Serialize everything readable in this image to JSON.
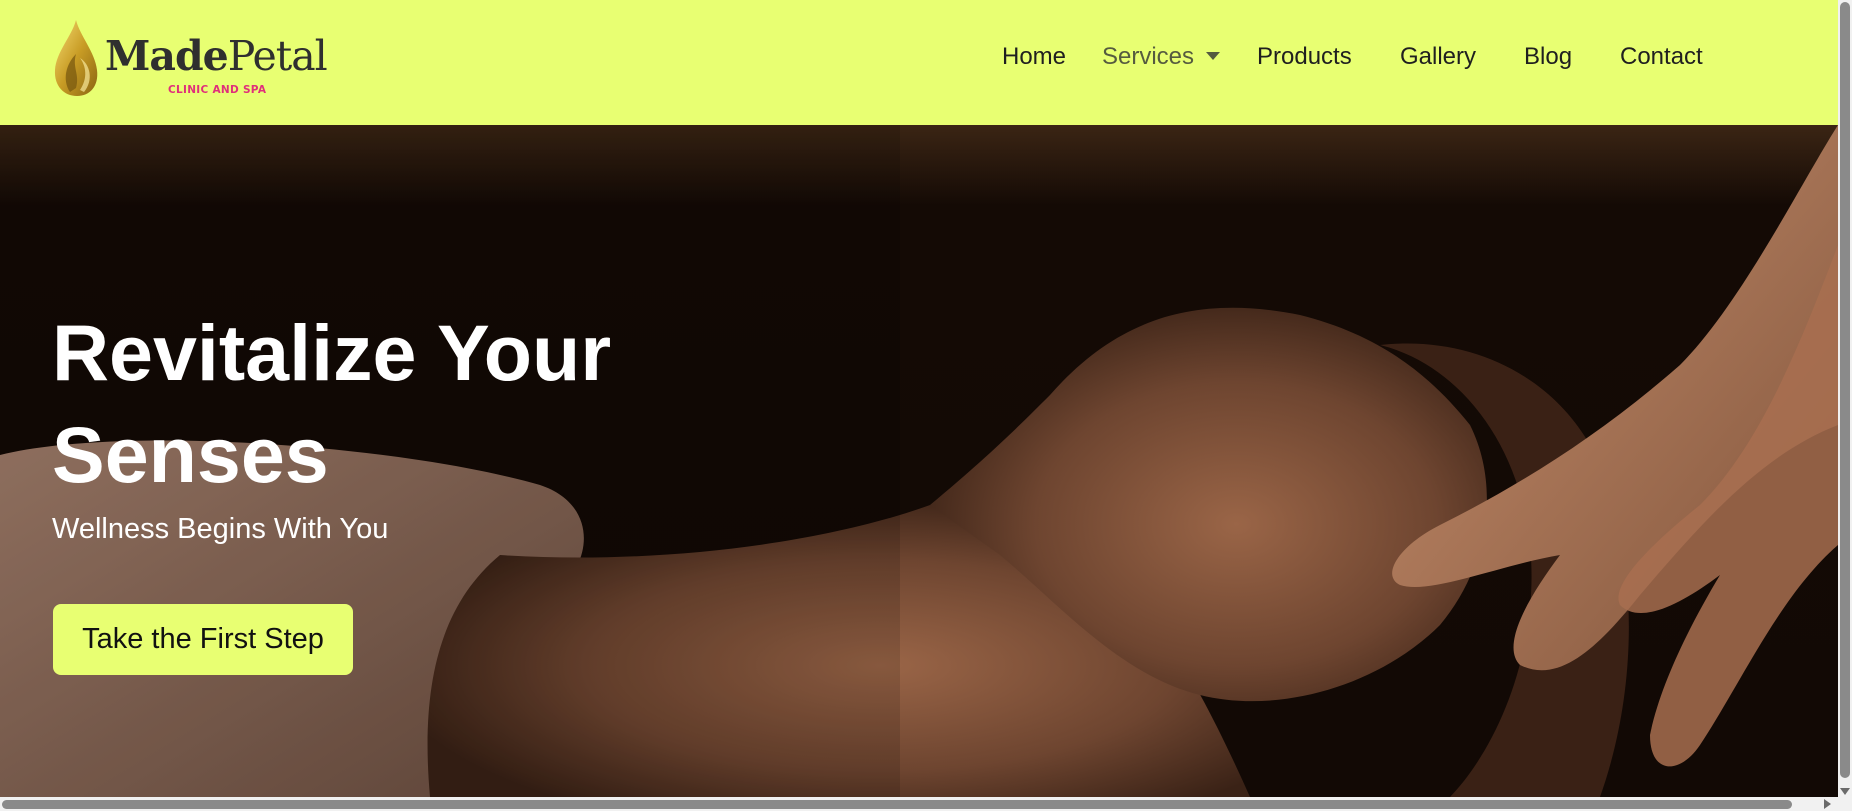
{
  "header": {
    "logo": {
      "brand_bold": "Made",
      "brand_light": "Petal",
      "tagline": "CLINIC AND SPA"
    },
    "nav": {
      "home": "Home",
      "services": "Services",
      "products": "Products",
      "gallery": "Gallery",
      "blog": "Blog",
      "contact": "Contact"
    }
  },
  "hero": {
    "title": "Revitalize Your Senses",
    "subtitle": "Wellness Begins With You",
    "cta_label": "Take the First Step"
  },
  "colors": {
    "accent": "#e8ff72",
    "tagline": "#e0307a",
    "text_dark": "#1f1f1f",
    "hero_bg": "#120905"
  },
  "icons": {
    "logo_mark": "golden-drop-flame-icon",
    "services_dropdown": "caret-down-icon"
  }
}
